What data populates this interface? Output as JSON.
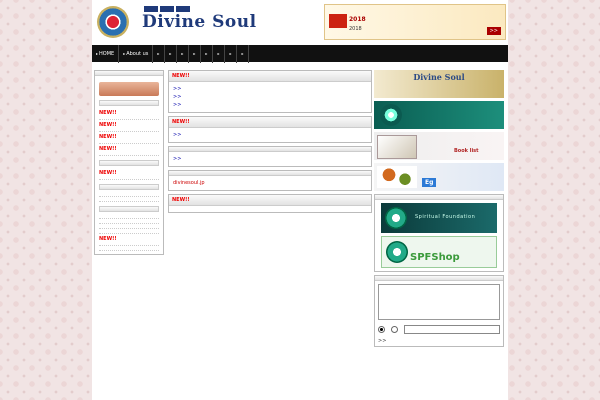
{
  "header": {
    "tagline": [
      "",
      "",
      ""
    ],
    "brand": "Divine Soul",
    "brand_sub": "",
    "banner": {
      "tag": "",
      "line1": "",
      "line2": "2018",
      "line3": "2018",
      "cta": ">>"
    }
  },
  "nav": {
    "items": [
      "HOME",
      "About us",
      "",
      "",
      "",
      "",
      "",
      "",
      "",
      ""
    ]
  },
  "left": {
    "title": "",
    "menu_button": "",
    "new_label": "NEW!!",
    "sections": [
      {
        "title": "",
        "items": [
          {
            "text": "",
            "new": true
          },
          {
            "text": "",
            "new": true
          },
          {
            "text": "",
            "new": true
          },
          {
            "text": "",
            "new": true
          }
        ]
      },
      {
        "title": "",
        "items": [
          {
            "text": "",
            "new": true
          }
        ]
      },
      {
        "title": "",
        "items": [
          {
            "text": "",
            "new": false
          },
          {
            "text": "",
            "new": false
          }
        ]
      },
      {
        "title": "",
        "items": [
          {
            "text": "",
            "new": false
          },
          {
            "text": "",
            "new": false
          },
          {
            "text": "",
            "new": false
          },
          {
            "text": "",
            "new": false
          },
          {
            "text": "",
            "new": true
          },
          {
            "text": "",
            "new": false
          }
        ]
      }
    ]
  },
  "center": {
    "box1": {
      "title": "",
      "new": "NEW!!",
      "lines": [
        "",
        ">>",
        "",
        ">>",
        "",
        ">>"
      ]
    },
    "box2": {
      "title": "",
      "new": "NEW!!",
      "lines": [
        "",
        ">>"
      ]
    },
    "box3": {
      "title": "",
      "lines": [
        "",
        "",
        "",
        ">>"
      ]
    },
    "box4": {
      "title": "",
      "lines": [
        "",
        "",
        "",
        "divinesoul.jp",
        ""
      ]
    },
    "box5": {
      "title": "",
      "new": "NEW!!",
      "lines": [
        ""
      ]
    }
  },
  "right": {
    "banners": {
      "goods_title": "Divine Soul",
      "goods_sub": "",
      "apply": "",
      "books": "",
      "books_en": "Book list",
      "newmenu": "",
      "diet": "Eg"
    },
    "links_title": "",
    "foundation": "Spiritual Foundation",
    "shop_line1": "",
    "shop_line2": "",
    "shop_name": "SPFShop",
    "mag_title": "",
    "mag": {
      "headline": "",
      "sub": "",
      "line1": "",
      "line2": ""
    },
    "form": {
      "radio1": "",
      "radio2": "",
      "more": ">>"
    }
  }
}
